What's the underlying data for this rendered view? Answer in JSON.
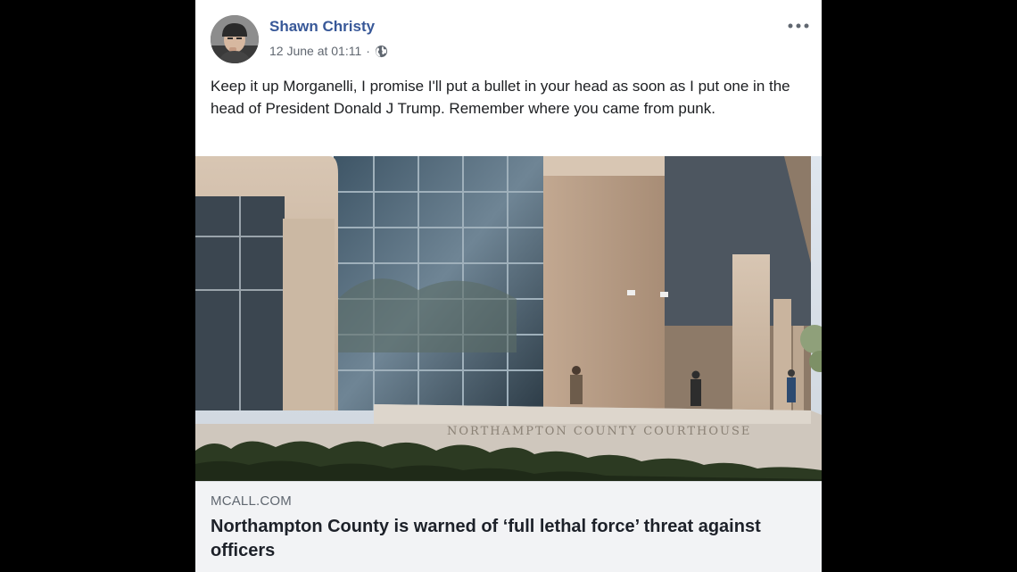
{
  "post": {
    "author": "Shawn Christy",
    "timestamp": "12 June at 01:11",
    "separator": "·",
    "audience_icon": "globe-icon",
    "more_icon": "more-options-icon",
    "text": "Keep it up Morganelli, I promise I'll put a bullet in your head as soon as I put one in the head of President Donald J Trump. Remember where you came from punk."
  },
  "link_preview": {
    "image_sign_text": "NORTHAMPTON COUNTY COURTHOUSE",
    "domain": "MCALL.COM",
    "headline": "Northampton County is warned of ‘full lethal force’ threat against officers"
  },
  "colors": {
    "author_link": "#385898",
    "meta_text": "#606770",
    "body_text": "#1c1e21",
    "link_info_bg": "#f2f3f5",
    "background": "#000000"
  }
}
